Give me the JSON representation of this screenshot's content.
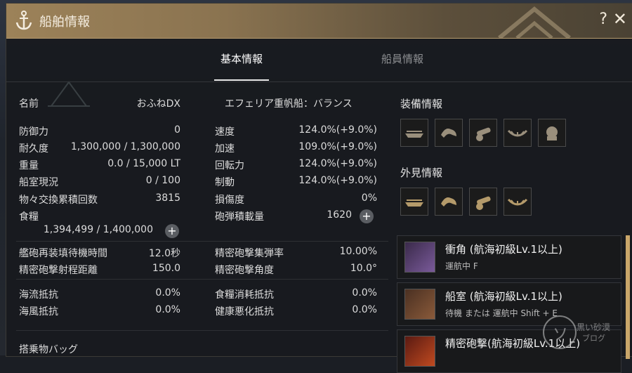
{
  "window": {
    "title": "船舶情報",
    "help": "?",
    "close": "✕"
  },
  "tabs": [
    {
      "label": "基本情報",
      "active": true
    },
    {
      "label": "船員情報",
      "active": false
    }
  ],
  "name_row": {
    "label": "名前",
    "value": "おふねDX",
    "ship_type": "エフェリア重帆船：バランス"
  },
  "left_stats": [
    {
      "label": "防御力",
      "value": "0"
    },
    {
      "label": "耐久度",
      "value": "1,300,000 / 1,300,000"
    },
    {
      "label": "重量",
      "value": "0.0 / 15,000 LT"
    },
    {
      "label": "船室現況",
      "value": "0 / 100"
    },
    {
      "label": "物々交換累積回数",
      "value": "3815"
    },
    {
      "label": "食糧",
      "value": "1,394,499 / 1,400,000"
    }
  ],
  "right_stats": [
    {
      "label": "速度",
      "value": "124.0%(+9.0%)"
    },
    {
      "label": "加速",
      "value": "109.0%(+9.0%)"
    },
    {
      "label": "回転力",
      "value": "124.0%(+9.0%)"
    },
    {
      "label": "制動",
      "value": "124.0%(+9.0%)"
    },
    {
      "label": "損傷度",
      "value": "0%"
    },
    {
      "label": "砲弾積載量",
      "value": "1620"
    }
  ],
  "cannon_stats": [
    {
      "label": "艦砲再装填待機時間",
      "value": "12.0秒"
    },
    {
      "label": "精密砲撃射程距離",
      "value": "150.0"
    }
  ],
  "cannon_stats_right": [
    {
      "label": "精密砲撃集弾率",
      "value": "10.00%"
    },
    {
      "label": "精密砲撃角度",
      "value": "10.0°"
    }
  ],
  "resist_stats": [
    {
      "label": "海流抵抗",
      "value": "0.0%"
    },
    {
      "label": "海風抵抗",
      "value": "0.0%"
    }
  ],
  "resist_stats_right": [
    {
      "label": "食糧消耗抵抗",
      "value": "0.0%"
    },
    {
      "label": "健康悪化抵抗",
      "value": "0.0%"
    }
  ],
  "bag": {
    "label": "搭乗物バッグ"
  },
  "equip": {
    "title": "装備情報",
    "slots": [
      "bow-figurehead-icon",
      "prow-ornament-icon",
      "cannon-icon",
      "sail-plate-icon",
      "crew-helmet-icon"
    ]
  },
  "appearance": {
    "title": "外見情報",
    "slots": [
      "bow-figurehead-icon",
      "prow-ornament-icon",
      "cannon-icon",
      "sail-plate-icon"
    ]
  },
  "skills": [
    {
      "name": "衝角 (航海初級Lv.1以上)",
      "sub": "運航中 F",
      "icon": "ram-skill-icon"
    },
    {
      "name": "船室 (航海初級Lv.1以上)",
      "sub": "待機 または 運航中 Shift + E",
      "icon": "cabin-skill-icon"
    },
    {
      "name": "精密砲撃(航海初級Lv.1以上)",
      "sub": "",
      "icon": "precision-cannon-skill-icon"
    }
  ],
  "watermark": {
    "logo": "ソ",
    "line1": "黒い砂漠",
    "line2": "ブログ"
  },
  "colors": {
    "title_bar": "#9c8259",
    "accent_gold": "#c9a66a",
    "panel_bg": "#18191b"
  }
}
